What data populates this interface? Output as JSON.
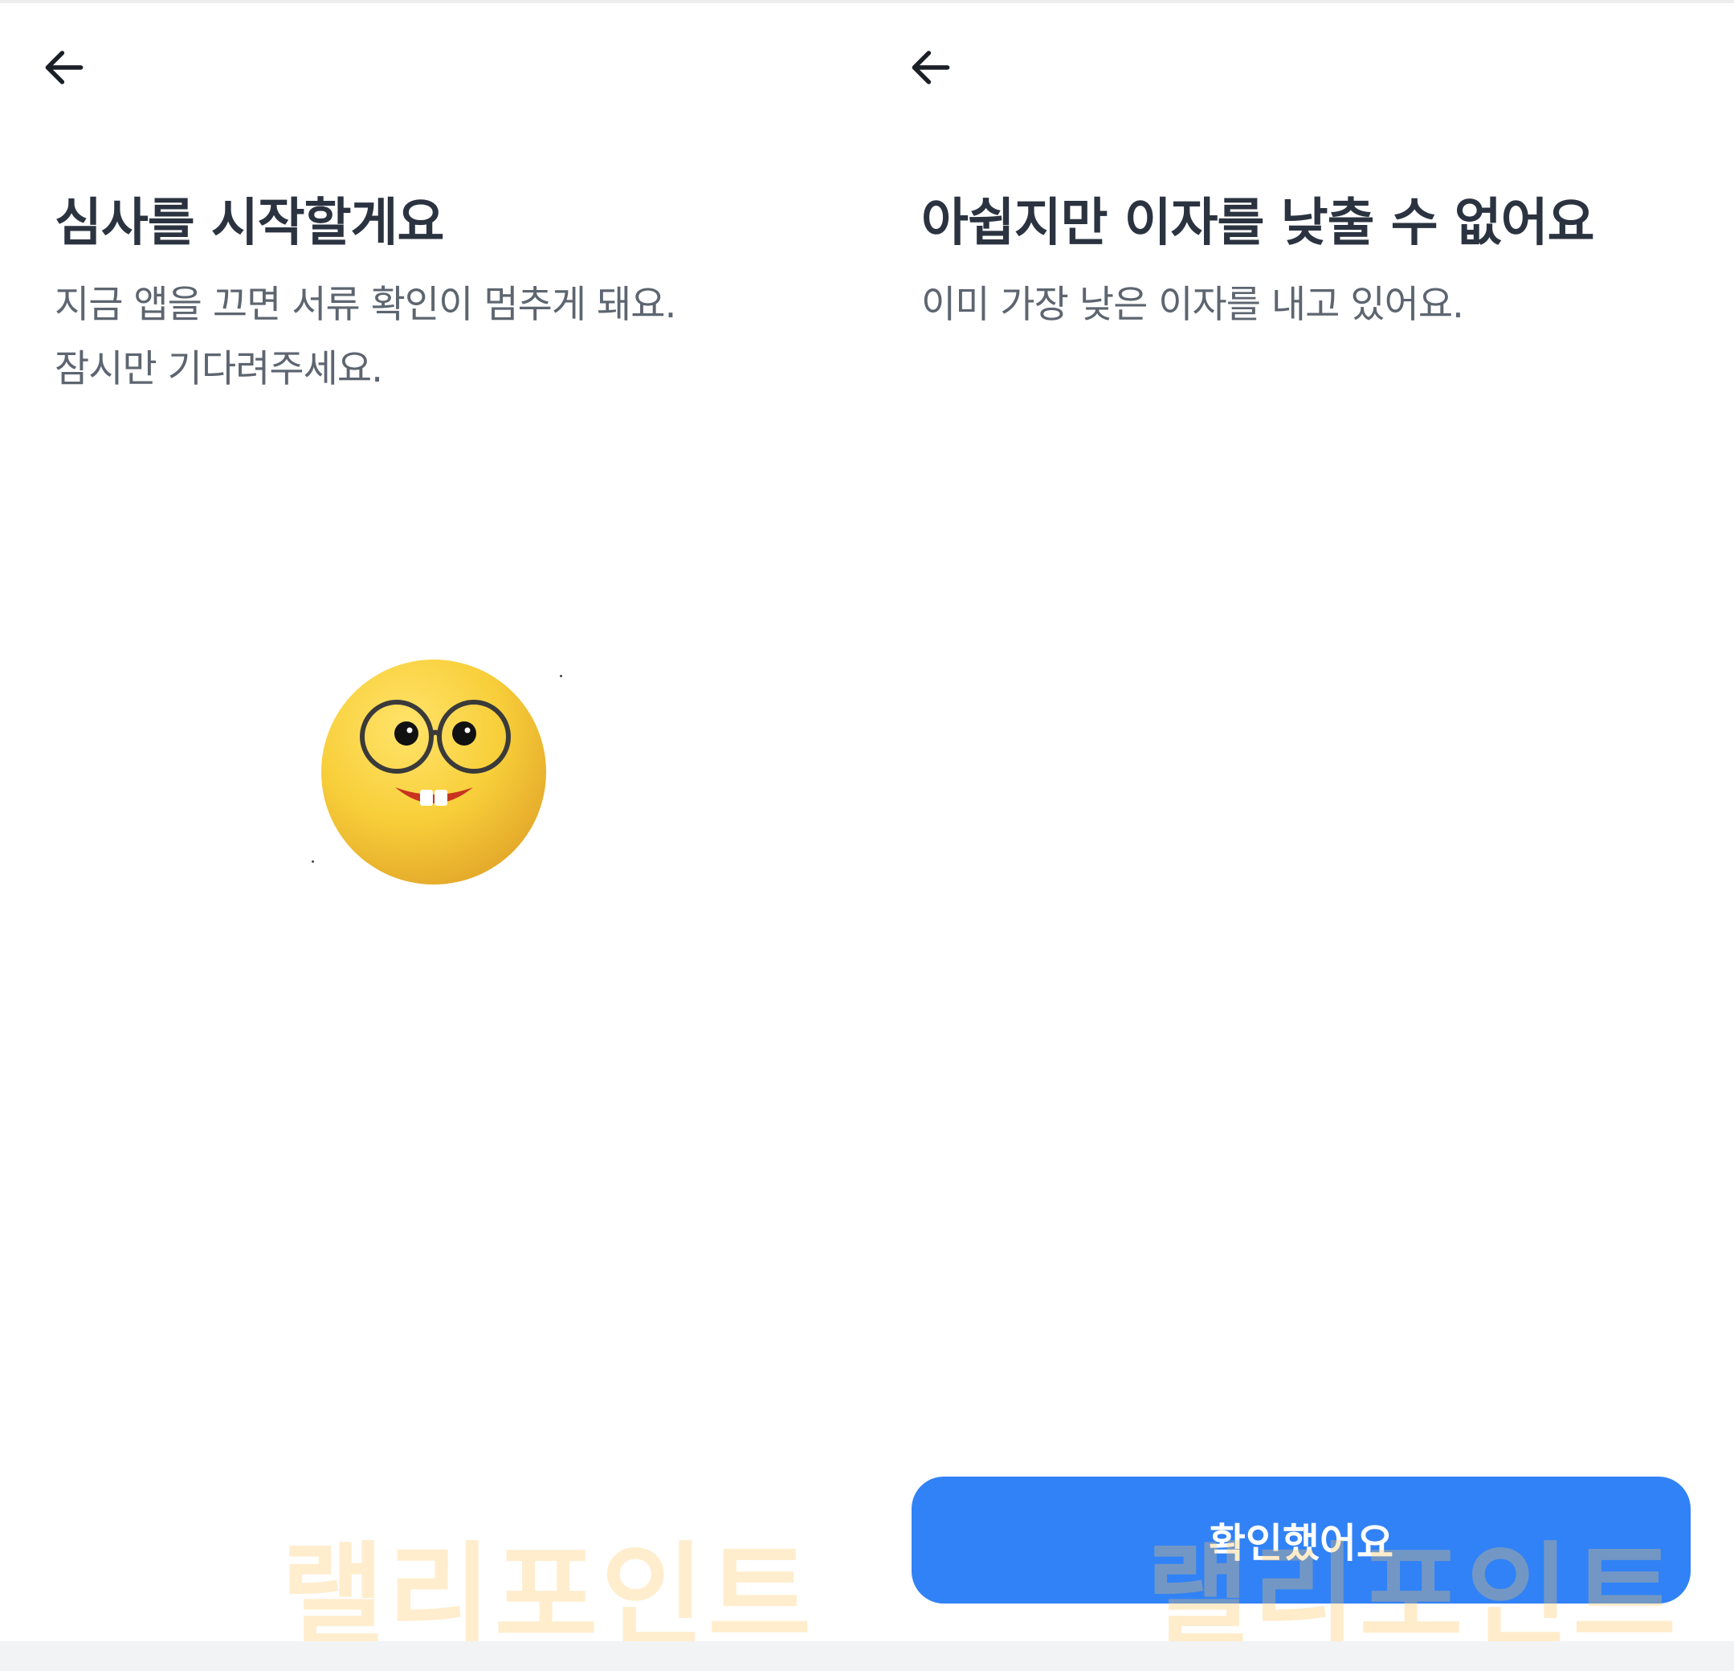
{
  "colors": {
    "background": "#ffffff",
    "title": "#2b3340",
    "body_text": "#5d6570",
    "primary_button": "#3182f6",
    "button_text": "#ffffff",
    "watermark": "#ffc45a"
  },
  "left_screen": {
    "back_icon": "arrow-left-icon",
    "title": "심사를 시작할게요",
    "description_line1": "지금 앱을 끄면 서류 확인이 멈추게 돼요.",
    "description_line2": "잠시만 기다려주세요.",
    "illustration": "nerd-face-emoji-icon"
  },
  "right_screen": {
    "back_icon": "arrow-left-icon",
    "title": "아쉽지만 이자를 낮출 수 없어요",
    "description": "이미 가장 낮은 이자를 내고 있어요.",
    "confirm_button_label": "확인했어요"
  },
  "watermark_text": "랠리포인트"
}
